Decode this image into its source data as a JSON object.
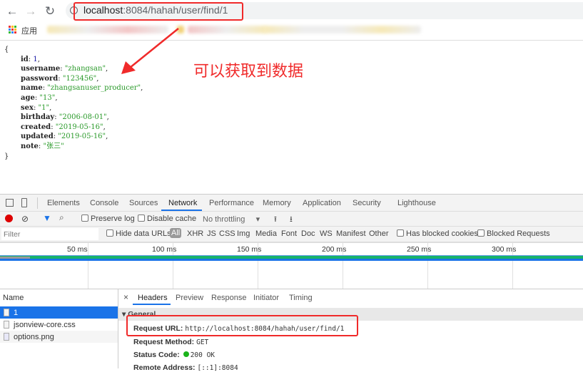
{
  "browser": {
    "url_host": "localhost",
    "url_rest": ":8084/hahah/user/find/1",
    "apps_label": "应用"
  },
  "json_view": {
    "open": "{",
    "close": "}",
    "fields": [
      {
        "key": "id",
        "value": "1",
        "type": "number"
      },
      {
        "key": "username",
        "value": "\"zhangsan\"",
        "type": "string"
      },
      {
        "key": "password",
        "value": "\"123456\"",
        "type": "string"
      },
      {
        "key": "name",
        "value": "\"zhangsanuser_producer\"",
        "type": "string"
      },
      {
        "key": "age",
        "value": "\"13\"",
        "type": "string"
      },
      {
        "key": "sex",
        "value": "\"1\"",
        "type": "string"
      },
      {
        "key": "birthday",
        "value": "\"2006-08-01\"",
        "type": "string"
      },
      {
        "key": "created",
        "value": "\"2019-05-16\"",
        "type": "string"
      },
      {
        "key": "updated",
        "value": "\"2019-05-16\"",
        "type": "string"
      },
      {
        "key": "note",
        "value": "\"张三\"",
        "type": "string",
        "last": true
      }
    ]
  },
  "annotation": {
    "text": "可以获取到数据",
    "color": "#f02a2a"
  },
  "devtools": {
    "tabs": [
      "Elements",
      "Console",
      "Sources",
      "Network",
      "Performance",
      "Memory",
      "Application",
      "Security",
      "Lighthouse"
    ],
    "active_tab": "Network",
    "toolbar": {
      "preserve_log": "Preserve log",
      "disable_cache": "Disable cache",
      "throttling": "No throttling"
    },
    "filter": {
      "placeholder": "Filter",
      "hide_data_urls": "Hide data URLs",
      "types": [
        "All",
        "XHR",
        "JS",
        "CSS",
        "Img",
        "Media",
        "Font",
        "Doc",
        "WS",
        "Manifest",
        "Other"
      ],
      "has_blocked_cookies": "Has blocked cookies",
      "blocked_requests": "Blocked Requests"
    },
    "timeline_ticks": [
      "50 ms",
      "100 ms",
      "150 ms",
      "200 ms",
      "250 ms",
      "300 ms"
    ],
    "name_header": "Name",
    "requests": [
      "1",
      "jsonview-core.css",
      "options.png"
    ],
    "detail_tabs": [
      "Headers",
      "Preview",
      "Response",
      "Initiator",
      "Timing"
    ],
    "general_label": "General",
    "headers": [
      {
        "label": "Request URL:",
        "value": "http://localhost:8084/hahah/user/find/1"
      },
      {
        "label": "Request Method:",
        "value": "GET"
      },
      {
        "label": "Status Code:",
        "value": "200 OK"
      },
      {
        "label": "Remote Address:",
        "value": "[::1]:8084"
      }
    ]
  }
}
